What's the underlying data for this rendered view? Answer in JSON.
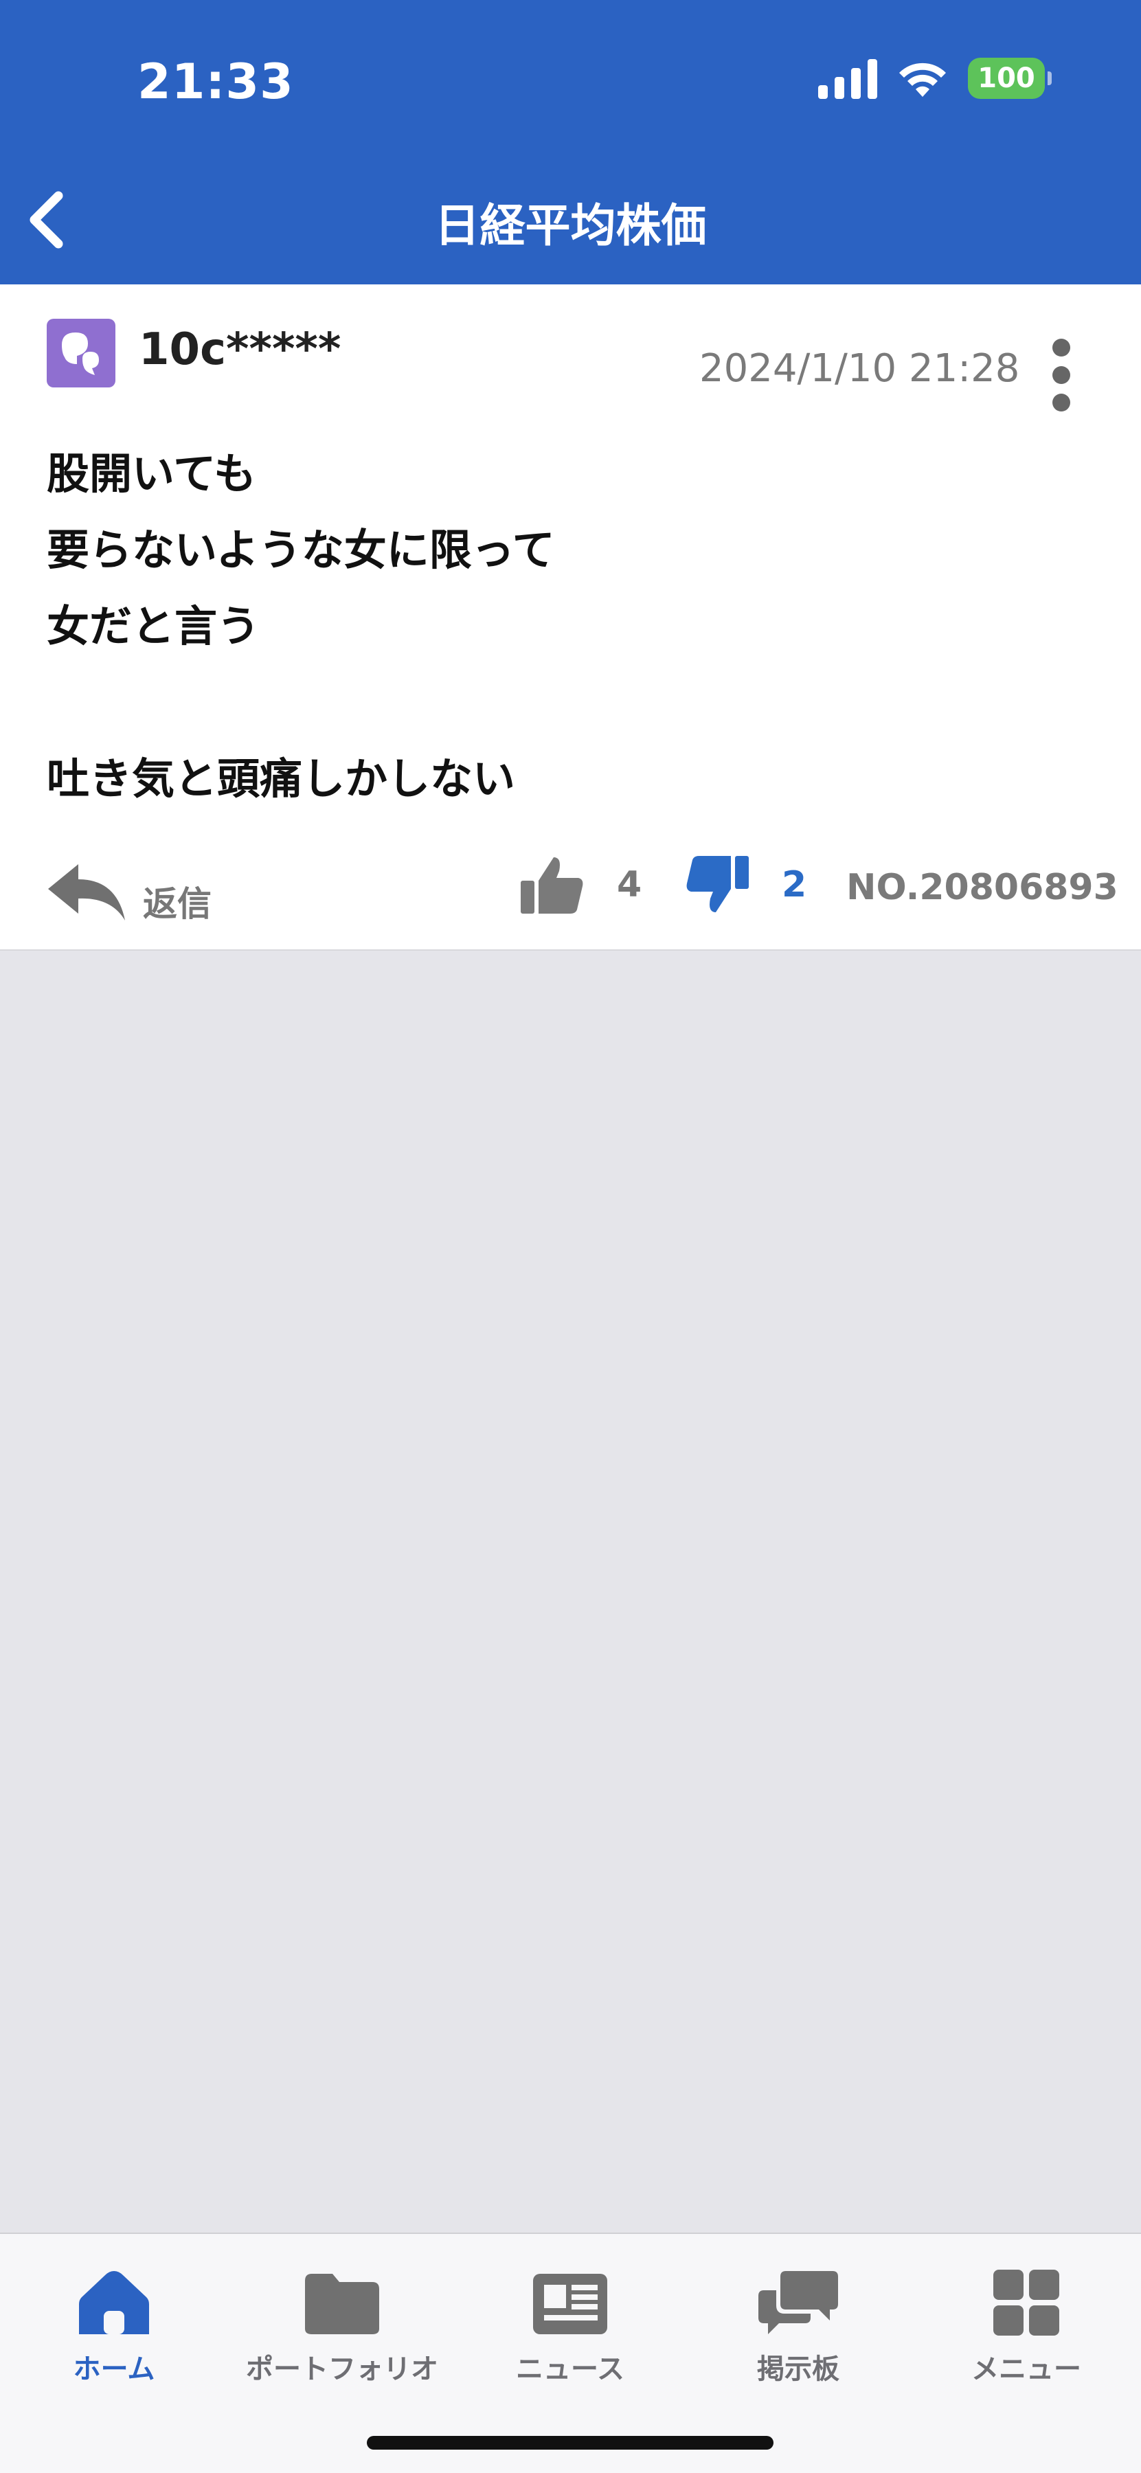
{
  "status_bar": {
    "time": "21:33",
    "battery": "100"
  },
  "nav": {
    "title": "日経平均株価"
  },
  "post": {
    "username": "10c*****",
    "date": "2024/1/10 21:28",
    "body": "股開いても\n要らないような女に限って\n女だと言う\n\n吐き気と頭痛しかしない",
    "reply_label": "返信",
    "likes": "4",
    "dislikes": "2",
    "number": "NO.20806893"
  },
  "tabs": [
    {
      "label": "ホーム",
      "icon": "home-icon",
      "active": true
    },
    {
      "label": "ポートフォリオ",
      "icon": "folder-icon",
      "active": false
    },
    {
      "label": "ニュース",
      "icon": "newspaper-icon",
      "active": false
    },
    {
      "label": "掲示板",
      "icon": "chat-bubbles-icon",
      "active": false
    },
    {
      "label": "メニュー",
      "icon": "grid-icon",
      "active": false
    }
  ],
  "colors": {
    "header_bg": "#2b62c2",
    "accent": "#2b62c2",
    "dislike": "#2b6bc6",
    "avatar_bg": "#8f6fd0",
    "battery": "#5dc35a"
  }
}
